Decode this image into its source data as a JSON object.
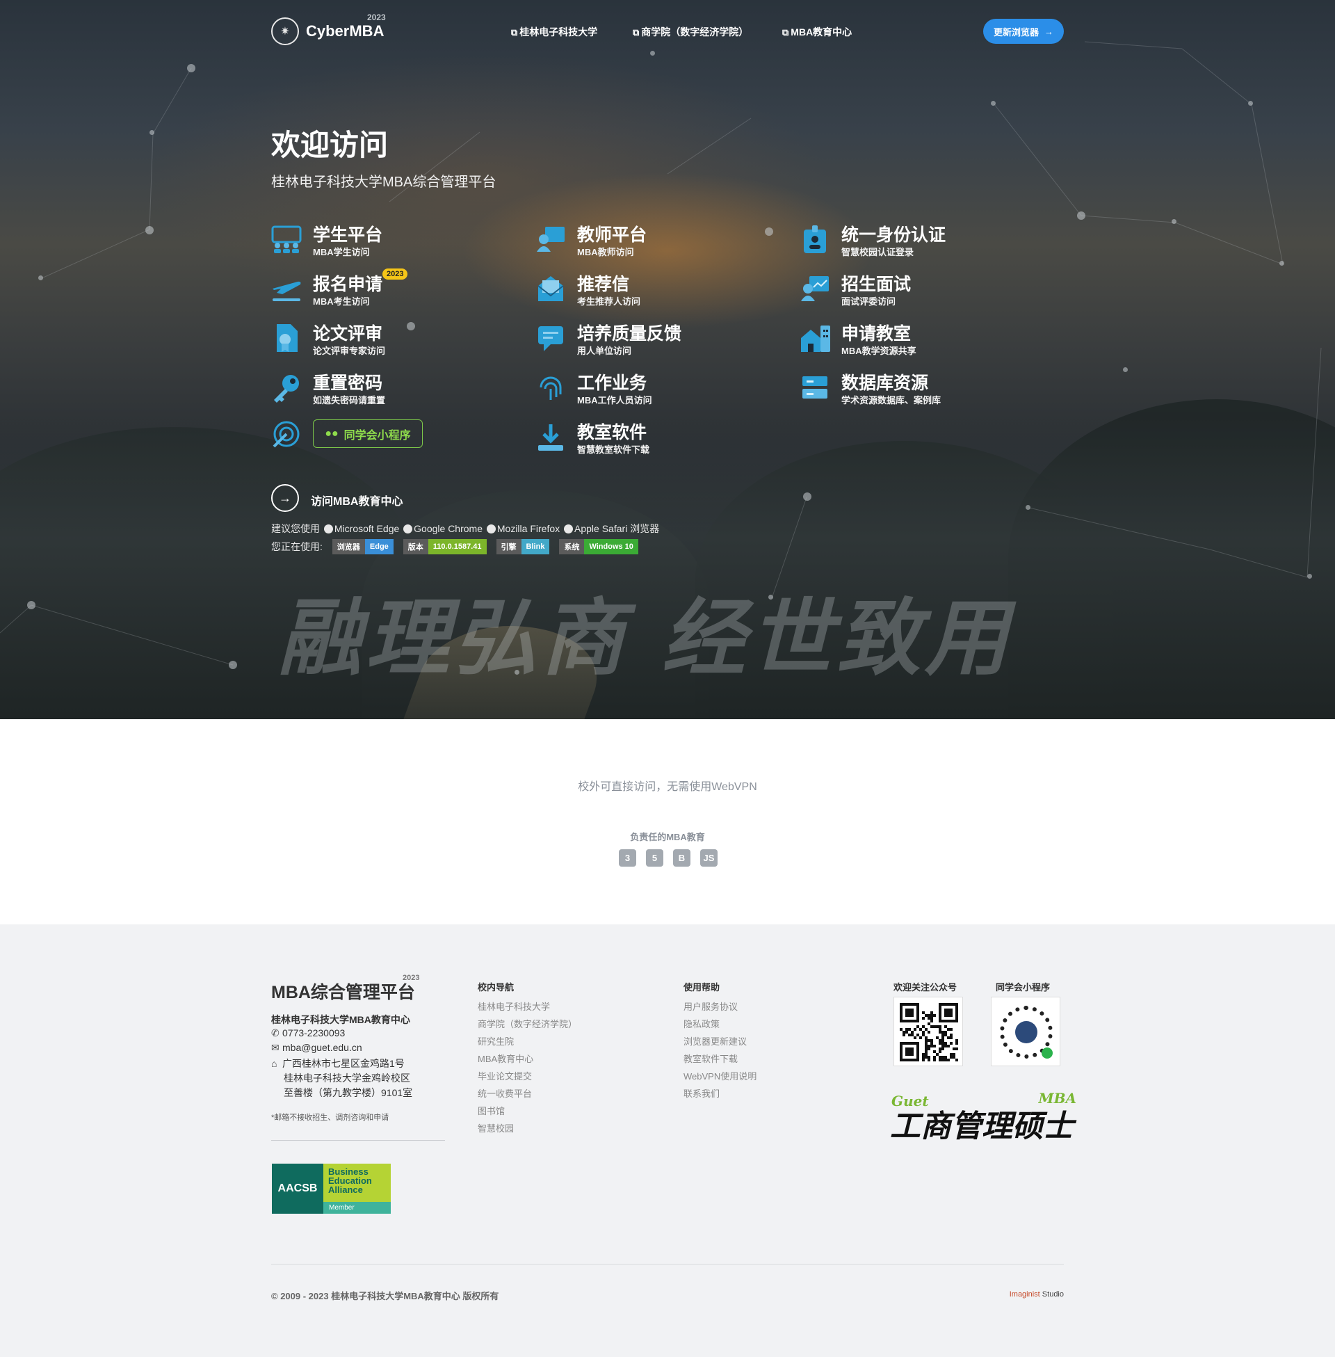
{
  "header": {
    "logo_text": "CyberMBA",
    "logo_year": "2023",
    "nav": [
      "桂林电子科技大学",
      "商学院（数字经济学院）",
      "MBA教育中心"
    ],
    "update_button": "更新浏览器"
  },
  "hero": {
    "title": "欢迎访问",
    "subtitle": "桂林电子科技大学MBA综合管理平台",
    "badge_2023": "2023",
    "entries": [
      {
        "title": "学生平台",
        "sub": "MBA学生访问",
        "icon": "students-icon"
      },
      {
        "title": "教师平台",
        "sub": "MBA教师访问",
        "icon": "teacher-icon"
      },
      {
        "title": "统一身份认证",
        "sub": "智慧校园认证登录",
        "icon": "id-badge-icon"
      },
      {
        "title": "报名申请",
        "sub": "MBA考生访问",
        "icon": "plane-icon"
      },
      {
        "title": "推荐信",
        "sub": "考生推荐人访问",
        "icon": "envelope-icon"
      },
      {
        "title": "招生面试",
        "sub": "面试评委访问",
        "icon": "presentation-icon"
      },
      {
        "title": "论文评审",
        "sub": "论文评审专家访问",
        "icon": "file-award-icon"
      },
      {
        "title": "培养质量反馈",
        "sub": "用人单位访问",
        "icon": "comment-icon"
      },
      {
        "title": "申请教室",
        "sub": "MBA教学资源共享",
        "icon": "building-icon"
      },
      {
        "title": "重置密码",
        "sub": "如遗失密码请重置",
        "icon": "key-icon"
      },
      {
        "title": "工作业务",
        "sub": "MBA工作人员访问",
        "icon": "fingerprint-icon"
      },
      {
        "title": "数据库资源",
        "sub": "学术资源数据库、案例库",
        "icon": "database-icon"
      },
      {
        "title": "教室软件",
        "sub": "智慧教室软件下载",
        "icon": "download-icon"
      }
    ],
    "wechat_button": "同学会小程序",
    "visit_link": "访问MBA教育中心",
    "recommend": {
      "prefix": "建议您使用",
      "browsers": [
        "Microsoft Edge",
        "Google Chrome",
        "Mozilla Firefox",
        "Apple Safari"
      ],
      "suffix": "浏览器"
    },
    "using": {
      "label": "您正在使用:",
      "shields": [
        {
          "k": "浏览器",
          "v": "Edge",
          "color": "#3a8fd8"
        },
        {
          "k": "版本",
          "v": "110.0.1587.41",
          "color": "#7cb52a"
        },
        {
          "k": "引擎",
          "v": "Blink",
          "color": "#42a8c8"
        },
        {
          "k": "系统",
          "v": "Windows 10",
          "color": "#3bab35"
        }
      ]
    },
    "calligraphy": "融理弘商 经世致用"
  },
  "middle": {
    "note": "校外可直接访问，无需使用WebVPN",
    "tagline": "负责任的MBA教育",
    "tech": [
      "3",
      "5",
      "B",
      "JS"
    ]
  },
  "footer": {
    "title": "MBA综合管理平台",
    "year": "2023",
    "org": "桂林电子科技大学MBA教育中心",
    "phone": "0773-2230093",
    "email": "mba@guet.edu.cn",
    "address": [
      "广西桂林市七星区金鸡路1号",
      "桂林电子科技大学金鸡岭校区",
      "至善楼（第九教学楼）9101室"
    ],
    "note": "*邮箱不接收招生、调剂咨询和申请",
    "aacsb": {
      "left": "AACSB",
      "right": "Business Education Alliance",
      "member": "Member"
    },
    "col1": {
      "title": "校内导航",
      "items": [
        "桂林电子科技大学",
        "商学院（数字经济学院）",
        "研究生院",
        "MBA教育中心",
        "毕业论文提交",
        "统一收费平台",
        "图书馆",
        "智慧校园"
      ]
    },
    "col2": {
      "title": "使用帮助",
      "items": [
        "用户服务协议",
        "隐私政策",
        "浏览器更新建议",
        "教室软件下载",
        "WebVPN使用说明",
        "联系我们"
      ]
    },
    "qr1_title": "欢迎关注公众号",
    "qr2_title": "同学会小程序",
    "brand": {
      "guet": "Guet",
      "main": "工商管理硕士",
      "mba": "MBA"
    },
    "copyright": "© 2009 - 2023 桂林电子科技大学MBA教育中心 版权所有",
    "studio": {
      "red": "Imaginist",
      "rest": " Studio"
    }
  }
}
